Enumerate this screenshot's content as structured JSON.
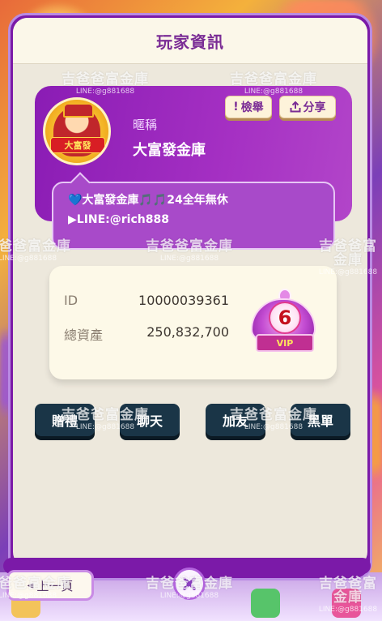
{
  "dialog": {
    "title": "玩家資訊",
    "nickname_label": "暱稱",
    "nickname": "大富發金庫",
    "avatar_plate": "大富發",
    "report_label": "檢舉",
    "report_icon_text": "!",
    "share_label": "分享",
    "signature": "💙大富發金庫🎵🎵24全年無休 ▶LINE:@rich888"
  },
  "info": {
    "id_label": "ID",
    "id_value": "10000039361",
    "assets_label": "總資產",
    "assets_value": "250,832,700",
    "vip_level": "6",
    "vip_text": "VIP"
  },
  "actions": {
    "gift": "贈禮",
    "chat": "聊天",
    "add_friend": "加友",
    "blacklist": "黑單"
  },
  "nav": {
    "prev_label": "上一頁"
  },
  "watermark": {
    "text": "吉爸爸富金庫",
    "sub": "LINE:@g881688"
  },
  "colors": {
    "accent": "#7b1aa8",
    "title": "#7a2c95",
    "button_dark": "#1a3547"
  }
}
